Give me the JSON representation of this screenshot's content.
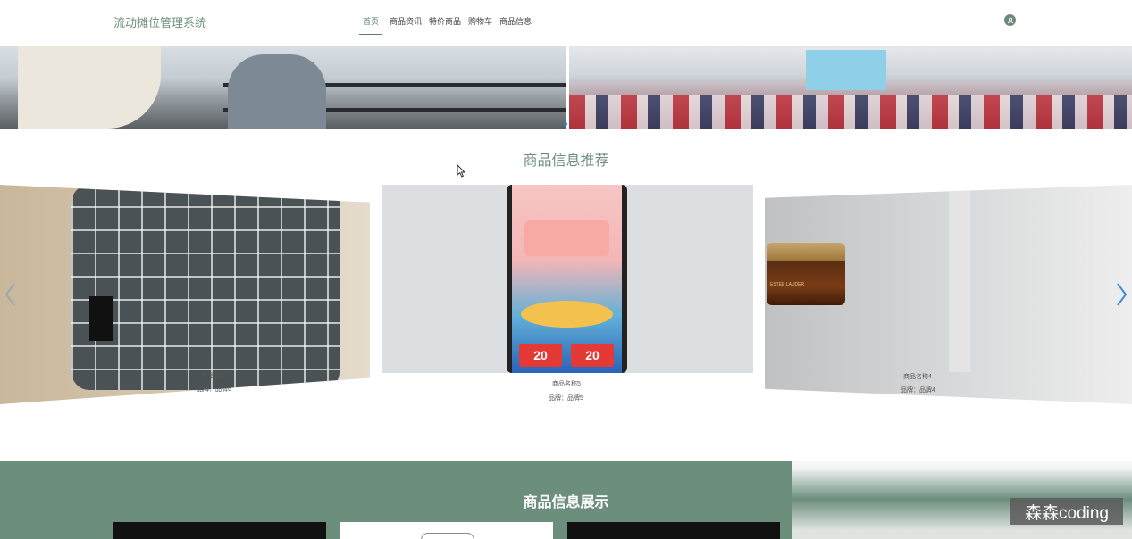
{
  "header": {
    "app_title": "流动摊位管理系统",
    "nav": [
      {
        "label": "首页",
        "active": true
      },
      {
        "label": "商品资讯",
        "active": false
      },
      {
        "label": "特价商品",
        "active": false
      },
      {
        "label": "购物车",
        "active": false
      },
      {
        "label": "商品信息",
        "active": false
      }
    ],
    "avatar_icon": "user-icon"
  },
  "banner": {
    "left_image": "supermarket-shelves-photo",
    "right_image": "clothing-store-photo",
    "indicator_color": "#1e88e5"
  },
  "recommend": {
    "title": "商品信息推荐",
    "cards": [
      {
        "name": "商品名称6",
        "brand": "品牌：品牌6",
        "image": "plaid-pillow-photo"
      },
      {
        "name": "商品名称5",
        "brand": "品牌：品牌5",
        "image": "phone-promo-photo",
        "coupon_a": "20",
        "coupon_b": "20"
      },
      {
        "name": "商品名称4",
        "brand": "品牌：品牌4",
        "image": "cream-jar-photo",
        "jar_text": "ESTEE LAUDER"
      }
    ],
    "prev_icon": "chevron-left-icon",
    "next_icon": "chevron-right-icon"
  },
  "showcase": {
    "title": "商品信息展示"
  },
  "watermark": "森森coding",
  "colors": {
    "accent": "#6c8e7d",
    "title_green": "#6f8f7e",
    "arrow_blue": "#3b8ed6"
  }
}
